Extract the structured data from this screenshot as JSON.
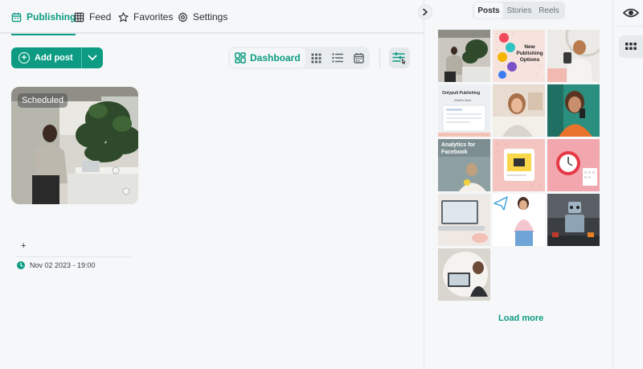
{
  "nav": {
    "tabs": [
      {
        "label": "Publishing",
        "icon": "calendar-icon",
        "active": true
      },
      {
        "label": "Feed",
        "icon": "table-icon",
        "active": false
      },
      {
        "label": "Favorites",
        "icon": "star-icon",
        "active": false
      },
      {
        "label": "Settings",
        "icon": "gear-icon",
        "active": false
      }
    ]
  },
  "toolbar": {
    "add_post_label": "Add post",
    "dashboard_label": "Dashboard"
  },
  "post": {
    "badge": "Scheduled",
    "plus": "+",
    "datetime": "Nov 02 2023 - 19:00"
  },
  "preview": {
    "tabs": [
      "Posts",
      "Stories",
      "Reels"
    ],
    "active_tab": "Posts",
    "tiles": {
      "t2": "New Publishing Options",
      "t4a": "Onlypult Publishing",
      "t4b": "What's New",
      "t7": "Analytics for Facebook"
    },
    "load_more": "Load more"
  },
  "colors": {
    "accent": "#0d9c83",
    "background": "#f6f7f9"
  }
}
